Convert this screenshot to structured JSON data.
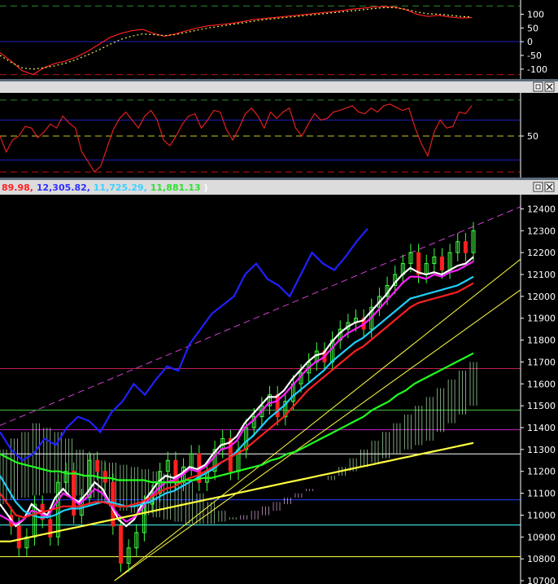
{
  "chart_data": [
    {
      "type": "line",
      "panel": "oscillator",
      "ylim": [
        -130,
        140
      ],
      "y_ticks": [
        100,
        50,
        0,
        -50,
        -100
      ],
      "reference_lines": [
        {
          "y": 130,
          "color": "#2a8a2a",
          "style": "dashed"
        },
        {
          "y": 0,
          "color": "#2020c0",
          "style": "solid"
        },
        {
          "y": -120,
          "color": "#c01010",
          "style": "dashed"
        }
      ],
      "series": [
        {
          "color": "#ff2020",
          "values": [
            -40,
            -70,
            -105,
            -120,
            -95,
            -80,
            -70,
            -55,
            -35,
            -10,
            15,
            30,
            40,
            45,
            30,
            20,
            28,
            40,
            50,
            58,
            62,
            66,
            72,
            80,
            84,
            88,
            92,
            96,
            100,
            104,
            108,
            112,
            118,
            122,
            126,
            128,
            126,
            116,
            100,
            92,
            96,
            90,
            86,
            88
          ]
        },
        {
          "color": "#f0f060",
          "style": "dotted",
          "values": [
            -50,
            -75,
            -95,
            -100,
            -95,
            -88,
            -78,
            -64,
            -48,
            -30,
            -10,
            8,
            20,
            28,
            26,
            22,
            26,
            34,
            42,
            50,
            56,
            62,
            68,
            74,
            80,
            84,
            88,
            92,
            96,
            100,
            104,
            108,
            112,
            116,
            120,
            124,
            124,
            118,
            108,
            102,
            100,
            96,
            92,
            90
          ]
        }
      ]
    },
    {
      "type": "line",
      "panel": "oscillator",
      "ylim": [
        0,
        100
      ],
      "y_ticks": [
        50
      ],
      "reference_lines": [
        {
          "y": 95,
          "color": "#2a8a2a",
          "style": "dashed"
        },
        {
          "y": 70,
          "color": "#2020c0",
          "style": "solid"
        },
        {
          "y": 50,
          "color": "#c8c820",
          "style": "dashed"
        },
        {
          "y": 20,
          "color": "#2020c0",
          "style": "solid"
        },
        {
          "y": 5,
          "color": "#c01010",
          "style": "dashed"
        }
      ],
      "series": [
        {
          "color": "#e02020",
          "values": [
            50,
            30,
            45,
            50,
            62,
            60,
            48,
            55,
            65,
            60,
            75,
            66,
            60,
            30,
            18,
            5,
            12,
            35,
            58,
            72,
            80,
            70,
            60,
            75,
            82,
            70,
            45,
            38,
            50,
            65,
            75,
            78,
            60,
            70,
            82,
            80,
            58,
            45,
            60,
            78,
            85,
            75,
            60,
            80,
            72,
            80,
            85,
            60,
            50,
            65,
            78,
            70,
            72,
            80,
            82,
            85,
            88,
            80,
            78,
            85,
            80,
            88,
            90,
            86,
            82,
            85,
            60,
            40,
            25,
            55,
            70,
            60,
            62,
            80,
            78,
            88
          ]
        }
      ]
    },
    {
      "type": "line",
      "panel": "price",
      "header": {
        "values": [
          {
            "text": "89.98,",
            "color": "#ff2020"
          },
          {
            "text": "12,305.82,",
            "color": "#3030ff"
          },
          {
            "text": "11,725.29,",
            "color": "#40d0ff"
          },
          {
            "text": "11,881.13",
            "color": "#30e030"
          },
          {
            "text": ")",
            "color": "#ffffff"
          }
        ]
      },
      "ylim": [
        10700,
        12450
      ],
      "y_ticks": [
        12400,
        12300,
        12200,
        12100,
        12000,
        11900,
        11800,
        11700,
        11600,
        11500,
        11400,
        11300,
        11200,
        11100,
        11000,
        10900,
        10800,
        10700
      ],
      "horizontal_lines": [
        {
          "y": 11670,
          "color": "#c02050"
        },
        {
          "y": 11480,
          "color": "#40c040"
        },
        {
          "y": 11390,
          "color": "#c020c0"
        },
        {
          "y": 11280,
          "color": "#ffffff"
        },
        {
          "y": 11070,
          "color": "#2040ff"
        },
        {
          "y": 10955,
          "color": "#40ffff"
        },
        {
          "y": 10810,
          "color": "#ffff40"
        }
      ],
      "trend_lines": [
        {
          "from": [
            0,
            11410
          ],
          "to": [
            1,
            12410
          ],
          "color": "#d040d0",
          "style": "dashed"
        },
        {
          "from": [
            0.22,
            10700
          ],
          "to": [
            1,
            12170
          ],
          "color": "#ffff40",
          "style": "solid"
        },
        {
          "from": [
            0.22,
            10700
          ],
          "to": [
            1,
            12030
          ],
          "color": "#ffff40",
          "style": "solid"
        }
      ],
      "price": [
        11000,
        10950,
        10850,
        10900,
        11050,
        10980,
        10900,
        11150,
        11200,
        11000,
        11080,
        11250,
        11200,
        11150,
        10950,
        10780,
        10850,
        10920,
        11050,
        11100,
        11200,
        11250,
        11150,
        11220,
        11280,
        11150,
        11200,
        11300,
        11350,
        11200,
        11300,
        11400,
        11450,
        11500,
        11550,
        11450,
        11520,
        11600,
        11650,
        11700,
        11750,
        11700,
        11800,
        11850,
        11880,
        11900,
        11850,
        11950,
        12000,
        12050,
        12100,
        12150,
        12200,
        12100,
        12150,
        12180,
        12120,
        12200,
        12250,
        12200,
        12300
      ],
      "series": [
        {
          "color": "#2020ff",
          "values": [
            11380,
            11300,
            11250,
            11280,
            11350,
            11320,
            11400,
            11450,
            11430,
            11380,
            11470,
            11520,
            11600,
            11550,
            11620,
            11680,
            11660,
            11780,
            11850,
            11920,
            11960,
            12000,
            12100,
            12150,
            12080,
            12050,
            12000,
            12100,
            12200,
            12150,
            12120,
            12180,
            12250,
            12310
          ]
        },
        {
          "color": "#ffffff",
          "values": [
            11050,
            11000,
            10950,
            10980,
            11050,
            11020,
            11000,
            11080,
            11120,
            11080,
            11060,
            11100,
            11150,
            11120,
            11050,
            10980,
            10950,
            10980,
            11050,
            11100,
            11150,
            11180,
            11170,
            11190,
            11220,
            11210,
            11230,
            11280,
            11320,
            11330,
            11360,
            11420,
            11460,
            11500,
            11540,
            11540,
            11570,
            11620,
            11660,
            11700,
            11730,
            11740,
            11790,
            11830,
            11860,
            11880,
            11890,
            11930,
            11970,
            12010,
            12060,
            12100,
            12130,
            12110,
            12100,
            12110,
            12100,
            12120,
            12140,
            12150,
            12180
          ]
        },
        {
          "color": "#ff20ff",
          "values": [
            11000,
            10980,
            10960,
            10980,
            11020,
            11010,
            10990,
            11050,
            11100,
            11080,
            11050,
            11080,
            11120,
            11100,
            11050,
            11000,
            10970,
            10990,
            11030,
            11080,
            11120,
            11150,
            11160,
            11180,
            11210,
            11200,
            11220,
            11260,
            11300,
            11310,
            11340,
            11400,
            11430,
            11470,
            11510,
            11520,
            11550,
            11590,
            11630,
            11670,
            11700,
            11720,
            11760,
            11800,
            11830,
            11850,
            11870,
            11900,
            11940,
            11980,
            12020,
            12060,
            12090,
            12090,
            12080,
            12100,
            12090,
            12110,
            12120,
            12140,
            12160
          ]
        },
        {
          "color": "#20d0ff",
          "values": [
            11180,
            11120,
            11060,
            11020,
            11000,
            10990,
            10990,
            11000,
            11020,
            11030,
            11030,
            11040,
            11050,
            11060,
            11060,
            11050,
            11040,
            11040,
            11050,
            11060,
            11080,
            11100,
            11110,
            11130,
            11150,
            11170,
            11190,
            11210,
            11240,
            11260,
            11290,
            11330,
            11360,
            11400,
            11440,
            11470,
            11500,
            11540,
            11570,
            11600,
            11630,
            11660,
            11700,
            11730,
            11760,
            11790,
            11810,
            11840,
            11870,
            11900,
            11930,
            11960,
            11990,
            12000,
            12010,
            12020,
            12030,
            12040,
            12050,
            12070,
            12090
          ]
        },
        {
          "color": "#ff2020",
          "values": [
            11100,
            11050,
            11000,
            10990,
            11000,
            11010,
            11020,
            11030,
            11040,
            11040,
            11040,
            11050,
            11060,
            11060,
            11050,
            11040,
            11040,
            11050,
            11060,
            11080,
            11100,
            11120,
            11130,
            11150,
            11170,
            11180,
            11200,
            11220,
            11240,
            11260,
            11280,
            11300,
            11330,
            11360,
            11390,
            11420,
            11450,
            11490,
            11530,
            11570,
            11600,
            11630,
            11660,
            11690,
            11720,
            11750,
            11770,
            11800,
            11830,
            11860,
            11890,
            11920,
            11950,
            11970,
            11980,
            11990,
            12000,
            12010,
            12020,
            12040,
            12060
          ]
        },
        {
          "color": "#20ff20",
          "values": [
            11280,
            11260,
            11240,
            11230,
            11220,
            11210,
            11200,
            11200,
            11190,
            11190,
            11180,
            11180,
            11170,
            11170,
            11160,
            11160,
            11160,
            11160,
            11150,
            11150,
            11150,
            11150,
            11160,
            11160,
            11170,
            11170,
            11180,
            11190,
            11200,
            11210,
            11220,
            11230,
            11250,
            11260,
            11280,
            11290,
            11310,
            11330,
            11350,
            11370,
            11390,
            11410,
            11430,
            11450,
            11480,
            11500,
            11520,
            11550,
            11570,
            11600,
            11620,
            11640,
            11660,
            11680,
            11700,
            11720,
            11740
          ]
        },
        {
          "color": "#ffff40",
          "values": [
            10880,
            10880,
            10890,
            10900,
            10910,
            10920,
            10930,
            10940,
            10950,
            10960,
            10970,
            10980,
            10990,
            11000,
            11010,
            11020,
            11030,
            11040,
            11050,
            11060,
            11070,
            11080,
            11090,
            11100,
            11110,
            11120,
            11130,
            11140,
            11150,
            11160,
            11170,
            11180,
            11190,
            11200,
            11210,
            11220,
            11230,
            11240,
            11250,
            11260,
            11270,
            11280,
            11290,
            11300,
            11310,
            11320,
            11330
          ]
        }
      ],
      "cloud": {
        "upper": [
          11300,
          11350,
          11380,
          11420,
          11400,
          11380,
          11350,
          11300,
          11280,
          11250,
          11240,
          11230,
          11220,
          11210,
          11200,
          11190,
          11180,
          11150,
          11100,
          11060,
          11020,
          10990,
          10980,
          10980,
          11000,
          11020,
          11050,
          11080,
          11110,
          11140,
          11180,
          11220,
          11260,
          11300,
          11340,
          11380,
          11420,
          11460,
          11500,
          11540,
          11580,
          11620,
          11660,
          11700
        ],
        "lower": [
          11050,
          11070,
          11080,
          11090,
          11100,
          11100,
          11100,
          11090,
          11080,
          11060,
          11040,
          11020,
          11010,
          11000,
          10990,
          10980,
          10970,
          10960,
          10960,
          10960,
          10970,
          10980,
          11000,
          11020,
          11040,
          11060,
          11080,
          11100,
          11120,
          11140,
          11160,
          11180,
          11200,
          11220,
          11240,
          11260,
          11280,
          11300,
          11320,
          11340,
          11380,
          11420,
          11460,
          11500
        ]
      }
    }
  ]
}
